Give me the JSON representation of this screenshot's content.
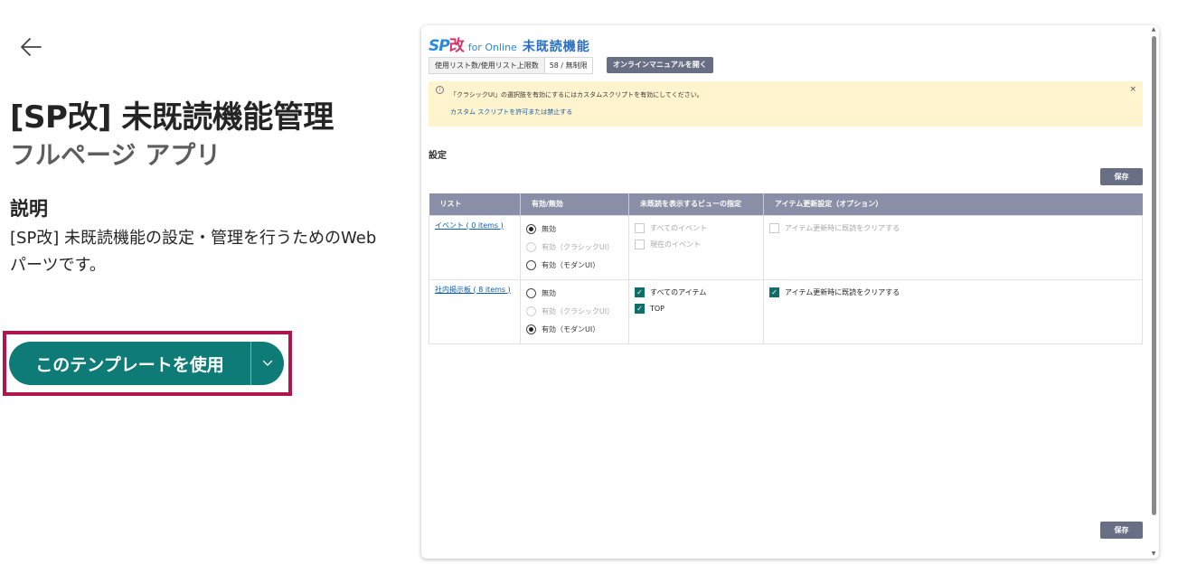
{
  "page": {
    "title": "[SP改] 未既読機能管理",
    "subtitle": "フルページ アプリ",
    "description_heading": "説明",
    "description_text": "[SP改] 未既読機能の設定・管理を行うためのWebパーツです。",
    "use_template_label": "このテンプレートを使用"
  },
  "icons": {
    "back": "arrow-left-icon",
    "dropdown": "chevron-down-icon",
    "info": "info-icon",
    "close": "close-icon",
    "check": "check-icon"
  },
  "colors": {
    "primary_button": "#0f7b77",
    "focus_outline": "#b0154e",
    "preview_button": "#686e84",
    "table_header": "#8a8ea6",
    "notice_background": "#fff4ce",
    "link": "#0b5cad",
    "checkbox_checked": "#0f6e6a",
    "logo_blue": "#2a8ad8",
    "logo_pink": "#d6336c"
  },
  "preview": {
    "logo": {
      "sp": "SP",
      "kai": "改",
      "for_online": "for Online",
      "main": "未既読機能"
    },
    "usage_label": "使用リスト数/使用リスト上限数",
    "usage_value": "58 / 無制限",
    "manual_button": "オンラインマニュアルを開く",
    "notice": {
      "info_glyph": "i",
      "text": "「クラシックUI」の選択肢を有効にするにはカスタムスクリプトを有効にしてください。",
      "link": "カスタム スクリプトを許可または禁止する",
      "close": "×"
    },
    "section_title": "設定",
    "save_label": "保存",
    "table": {
      "headers": [
        "リスト",
        "有効/無効",
        "未既読を表示するビューの指定",
        "アイテム更新設定（オプション）"
      ],
      "rows": [
        {
          "list": "イベント ( 0 items )",
          "radios": [
            "無効",
            "有効（クラシックUI）",
            "有効（モダンUI）"
          ],
          "views": [
            "すべてのイベント",
            "現在のイベント"
          ],
          "update": "アイテム更新時に既読をクリアする"
        },
        {
          "list": "社内掲示板 ( 8 items )",
          "radios": [
            "無効",
            "有効（クラシックUI）",
            "有効（モダンUI）"
          ],
          "views": [
            "すべてのアイテム",
            "TOP"
          ],
          "update": "アイテム更新時に既読をクリアする"
        }
      ]
    }
  }
}
